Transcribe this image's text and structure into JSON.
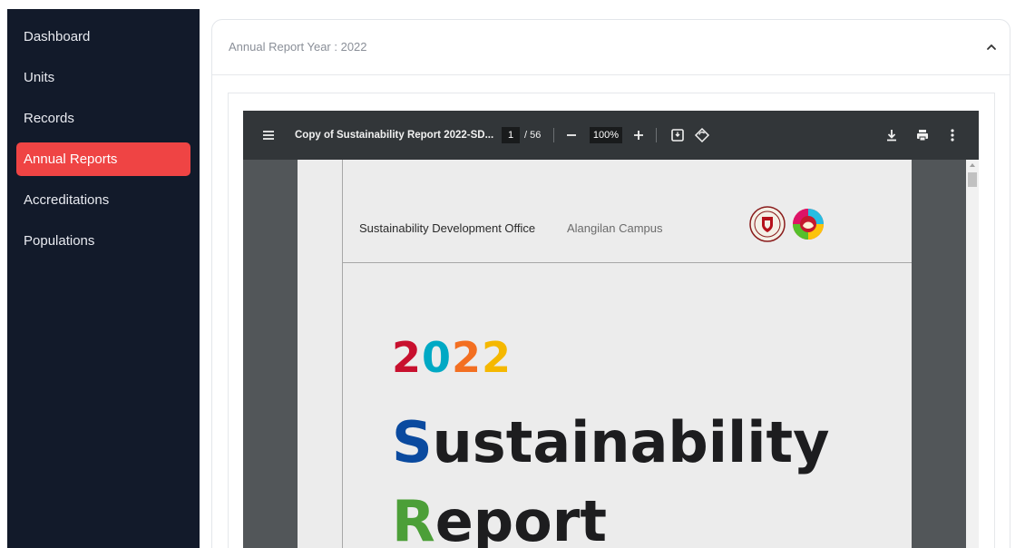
{
  "sidebar": {
    "items": [
      {
        "label": "Dashboard",
        "active": false
      },
      {
        "label": "Units",
        "active": false
      },
      {
        "label": "Records",
        "active": false
      },
      {
        "label": "Annual Reports",
        "active": true
      },
      {
        "label": "Accreditations",
        "active": false
      },
      {
        "label": "Populations",
        "active": false
      }
    ]
  },
  "card": {
    "title": "Annual Report Year : 2022",
    "collapse_icon": "chevron-up-icon"
  },
  "pdf_viewer": {
    "file_title": "Copy of Sustainability Report 2022-SD...",
    "current_page": "1",
    "total_pages": "/ 56",
    "zoom": "100%",
    "icons": [
      "menu-icon",
      "zoom-out-icon",
      "zoom-in-icon",
      "fit-page-icon",
      "rotate-icon",
      "download-icon",
      "print-icon",
      "more-vert-icon"
    ]
  },
  "document": {
    "office": "Sustainability Development Office",
    "campus": "Alangilan Campus",
    "year_digits": [
      "2",
      "0",
      "2",
      "2"
    ],
    "year_colors": [
      "#c8102e",
      "#00a9c4",
      "#f36f21",
      "#f5b800"
    ],
    "title_line1_initial": "S",
    "title_line1_rest": "ustainability",
    "title_line1_color": "#0a4a9f",
    "title_line2_initial": "R",
    "title_line2_rest": "eport",
    "title_line2_color": "#4c9f38"
  },
  "colors": {
    "sidebar_bg": "#121a2a",
    "active_item": "#ef4444",
    "toolbar_bg": "#323639",
    "viewer_bg": "#525659"
  }
}
